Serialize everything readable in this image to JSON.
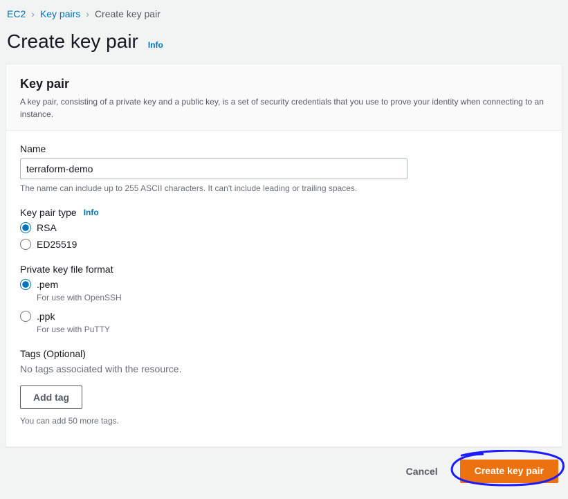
{
  "breadcrumb": {
    "ec2": "EC2",
    "keypairs": "Key pairs",
    "current": "Create key pair"
  },
  "header": {
    "title": "Create key pair",
    "info": "Info"
  },
  "panel": {
    "title": "Key pair",
    "desc": "A key pair, consisting of a private key and a public key, is a set of security credentials that you use to prove your identity when connecting to an instance."
  },
  "name": {
    "label": "Name",
    "value": "terraform-demo",
    "hint": "The name can include up to 255 ASCII characters. It can't include leading or trailing spaces."
  },
  "type": {
    "label": "Key pair type",
    "info": "Info",
    "rsa": "RSA",
    "ed25519": "ED25519"
  },
  "format": {
    "label": "Private key file format",
    "pem": ".pem",
    "pem_sub": "For use with OpenSSH",
    "ppk": ".ppk",
    "ppk_sub": "For use with PuTTY"
  },
  "tags": {
    "label": "Tags (Optional)",
    "empty": "No tags associated with the resource.",
    "add": "Add tag",
    "hint": "You can add 50 more tags."
  },
  "actions": {
    "cancel": "Cancel",
    "create": "Create key pair"
  }
}
